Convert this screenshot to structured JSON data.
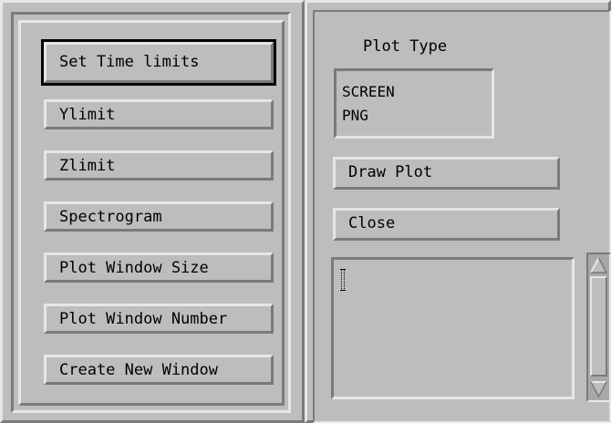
{
  "left_panel": {
    "buttons": [
      {
        "label": "Set Time limits"
      },
      {
        "label": "Ylimit"
      },
      {
        "label": "Zlimit"
      },
      {
        "label": "Spectrogram"
      },
      {
        "label": "Plot Window Size"
      },
      {
        "label": "Plot Window Number"
      },
      {
        "label": "Create New Window"
      }
    ]
  },
  "right_panel": {
    "plot_type_label": "Plot Type",
    "plot_type_options": [
      "SCREEN",
      "PNG"
    ],
    "draw_plot_label": "Draw Plot",
    "close_label": "Close",
    "output_text": ""
  },
  "colors": {
    "background": "#bdbdbd",
    "highlight": "#e6e6e6",
    "shadow": "#7a7a7a",
    "trough": "#a8a8a8"
  },
  "icons": {
    "scroll_up": "triangle-up-icon",
    "scroll_down": "triangle-down-icon",
    "text_cursor": "i-beam-cursor-icon"
  }
}
